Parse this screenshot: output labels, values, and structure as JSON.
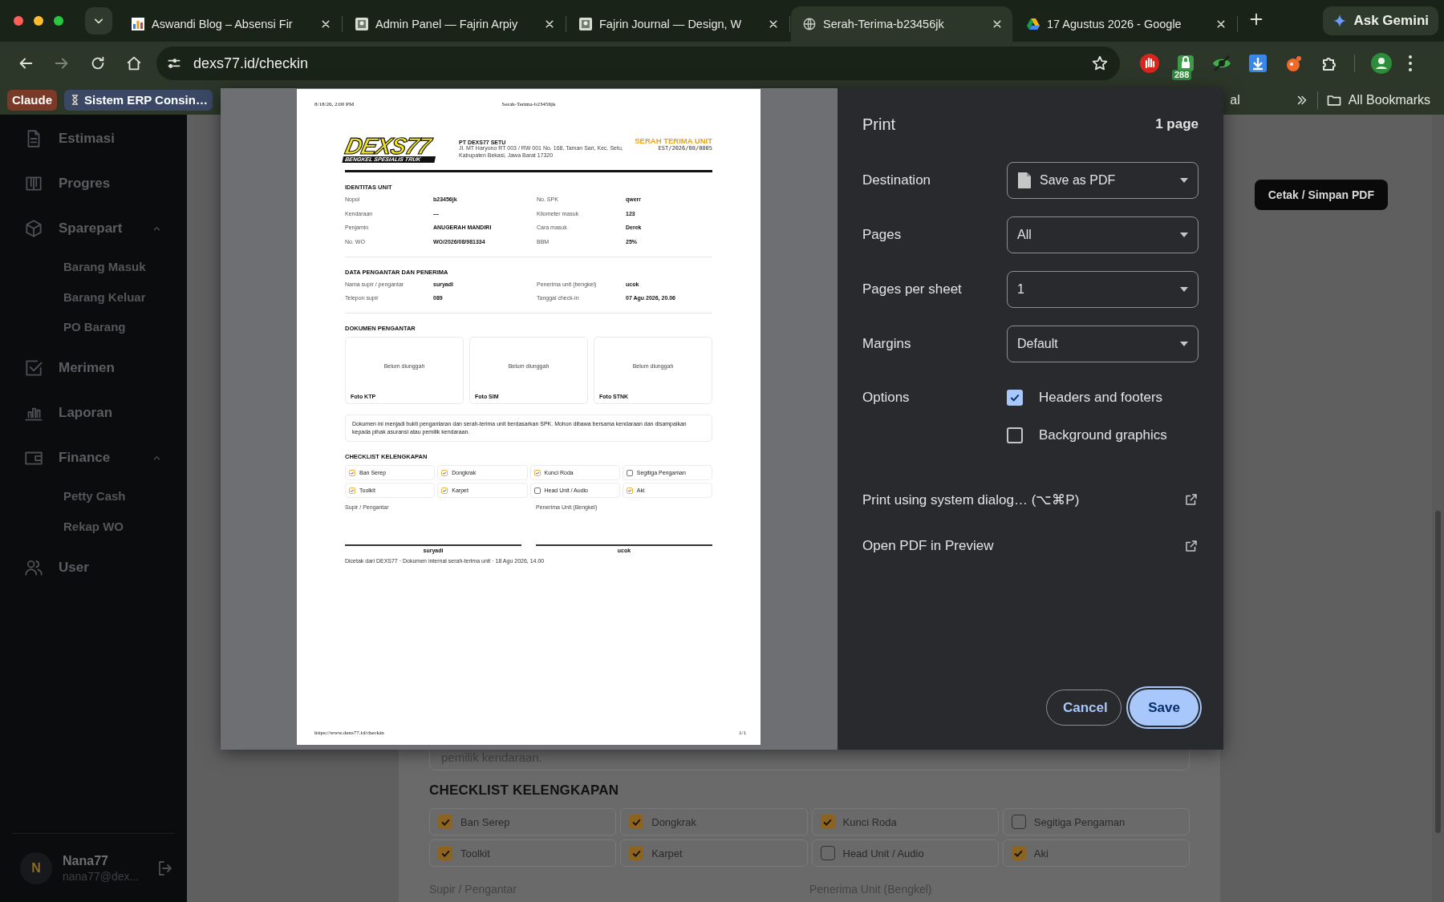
{
  "browser": {
    "tabs": [
      {
        "title": "Aswandi Blog – Absensi Fir",
        "selected": false
      },
      {
        "title": "Admin Panel — Fajrin Arpiy",
        "selected": false
      },
      {
        "title": "Fajrin Journal — Design, W",
        "selected": false
      },
      {
        "title": "Serah-Terima-b23456jk",
        "selected": true
      },
      {
        "title": "17 Agustus 2026 - Google",
        "selected": false
      }
    ],
    "gemini_button": "Ask Gemini",
    "address": "dexs77.id/checkin",
    "extension_badge": "288",
    "bookmarks": [
      {
        "label": "Claude",
        "kind": "chip"
      },
      {
        "label": "Sistem ERP Consin…",
        "kind": "hourglass"
      }
    ],
    "bookmark_tail": "al",
    "all_bookmarks": "All Bookmarks"
  },
  "sidebar": {
    "items": [
      {
        "label": "Estimasi"
      },
      {
        "label": "Progres"
      },
      {
        "label": "Sparepart",
        "expanded": true,
        "children": [
          {
            "label": "Barang Masuk"
          },
          {
            "label": "Barang Keluar"
          },
          {
            "label": "PO Barang"
          }
        ]
      },
      {
        "label": "Merimen"
      },
      {
        "label": "Laporan"
      },
      {
        "label": "Finance",
        "expanded": true,
        "children": [
          {
            "label": "Petty Cash"
          },
          {
            "label": "Rekap WO"
          }
        ]
      },
      {
        "label": "User"
      }
    ],
    "user": {
      "initial": "N",
      "name": "Nana77",
      "email": "nana77@dex..."
    }
  },
  "page": {
    "print_button": "Cetak / Simpan PDF",
    "note_tail": "pemilik kendaraan.",
    "checklist_title": "CHECKLIST KELENGKAPAN",
    "checklist": [
      {
        "label": "Ban Serep",
        "checked": true
      },
      {
        "label": "Dongkrak",
        "checked": true
      },
      {
        "label": "Kunci Roda",
        "checked": true
      },
      {
        "label": "Segitiga Pengaman",
        "checked": false
      },
      {
        "label": "Toolkit",
        "checked": true
      },
      {
        "label": "Karpet",
        "checked": true
      },
      {
        "label": "Head Unit / Audio",
        "checked": false
      },
      {
        "label": "Aki",
        "checked": true
      }
    ],
    "signatures": [
      "Supir / Pengantar",
      "Penerima Unit (Bengkel)"
    ]
  },
  "print_dialog": {
    "title": "Print",
    "page_count": "1 page",
    "settings": [
      {
        "label": "Destination",
        "value": "Save as PDF"
      },
      {
        "label": "Pages",
        "value": "All"
      },
      {
        "label": "Pages per sheet",
        "value": "1"
      },
      {
        "label": "Margins",
        "value": "Default"
      }
    ],
    "options_label": "Options",
    "options": [
      {
        "label": "Headers and footers",
        "checked": true
      },
      {
        "label": "Background graphics",
        "checked": false
      }
    ],
    "links": [
      "Print using system dialog… (⌥⌘P)",
      "Open PDF in Preview"
    ],
    "buttons": [
      {
        "label": "Cancel",
        "kind": "secondary"
      },
      {
        "label": "Save",
        "kind": "primary"
      }
    ]
  },
  "preview": {
    "header_left": "8/18/26, 2:00 PM",
    "header_center": "Serah-Terima-b23456jk",
    "footer_left": "https://www.dexs77.id/checkin",
    "footer_right": "1/1",
    "logo": {
      "mark": "DEXS77",
      "tagline": "BENGKEL SPESIALIS TRUK"
    },
    "company": "PT DEXS77 SETU",
    "address": "Jl. MT Haryono RT 003 / RW 001 No. 168, Taman Sari, Kec. Setu, Kabupaten Bekasi, Jawa Barat 17320",
    "doc_title": "SERAH TERIMA UNIT",
    "doc_number": "EST/2026/08/0805",
    "sections": [
      {
        "title": "IDENTITAS UNIT",
        "fields": [
          {
            "label": "Nopol",
            "value": "b23456jk"
          },
          {
            "label": "No. SPK",
            "value": "qwerr"
          },
          {
            "label": "Kendaraan",
            "value": "—"
          },
          {
            "label": "Kilometer masuk",
            "value": "123"
          },
          {
            "label": "Penjamin",
            "value": "ANUGERAH MANDIRI"
          },
          {
            "label": "Cara masuk",
            "value": "Derek"
          },
          {
            "label": "No. WO",
            "value": "WO/2026/08/981334"
          },
          {
            "label": "BBM",
            "value": "25%"
          }
        ]
      },
      {
        "title": "DATA PENGANTAR DAN PENERIMA",
        "fields": [
          {
            "label": "Nama supir / pengantar",
            "value": "suryadi"
          },
          {
            "label": "Penerima unit (bengkel)",
            "value": "ucok"
          },
          {
            "label": "Telepon supir",
            "value": "089"
          },
          {
            "label": "Tanggal check-in",
            "value": "07 Agu 2026, 20.06"
          }
        ]
      }
    ],
    "documents_title": "DOKUMEN PENGANTAR",
    "documents": [
      {
        "status": "Belum diunggah",
        "label": "Foto KTP"
      },
      {
        "status": "Belum diunggah",
        "label": "Foto SIM"
      },
      {
        "status": "Belum diunggah",
        "label": "Foto STNK"
      }
    ],
    "note": "Dokumen ini menjadi bukti pengantaran dan serah-terima unit berdasarkan SPK. Mohon dibawa bersama kendaraan dan disampaikan kepada pihak asuransi atau pemilik kendaraan.",
    "checklist_title": "CHECKLIST KELENGKAPAN",
    "checklist": [
      {
        "label": "Ban Serep",
        "checked": true
      },
      {
        "label": "Dongkrak",
        "checked": true
      },
      {
        "label": "Kunci Roda",
        "checked": true
      },
      {
        "label": "Segitiga Pengaman",
        "checked": false
      },
      {
        "label": "Toolkit",
        "checked": true
      },
      {
        "label": "Karpet",
        "checked": true
      },
      {
        "label": "Head Unit / Audio",
        "checked": false
      },
      {
        "label": "Aki",
        "checked": true
      }
    ],
    "signatures": [
      {
        "role": "Supir / Pengantar",
        "name": "suryadi"
      },
      {
        "role": "Penerima Unit (Bengkel)",
        "name": "ucok"
      }
    ],
    "printed_note": "Dicetak dari DEXS77 · Dokumen internal serah-terima unit · 18 Agu 2026, 14.00"
  }
}
